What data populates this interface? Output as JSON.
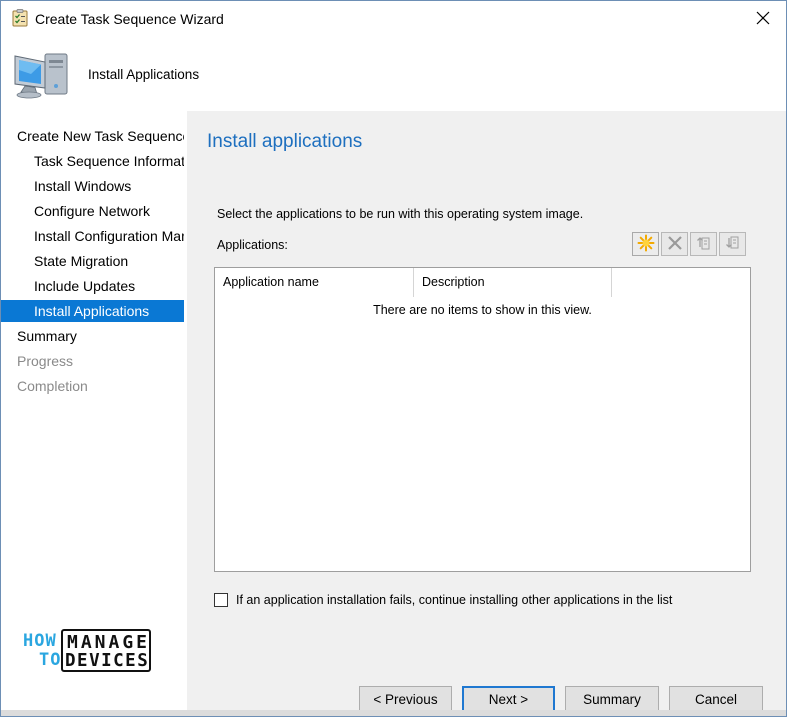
{
  "window": {
    "title": "Create Task Sequence Wizard"
  },
  "header": {
    "title": "Install Applications"
  },
  "nav": {
    "items": [
      {
        "label": "Create New Task Sequence",
        "state": "normal"
      },
      {
        "label": "Task Sequence Information",
        "state": "normal"
      },
      {
        "label": "Install Windows",
        "state": "normal"
      },
      {
        "label": "Configure Network",
        "state": "normal"
      },
      {
        "label": "Install Configuration Manager",
        "state": "normal"
      },
      {
        "label": "State Migration",
        "state": "normal"
      },
      {
        "label": "Include Updates",
        "state": "normal"
      },
      {
        "label": "Install Applications",
        "state": "selected"
      },
      {
        "label": "Summary",
        "state": "normal"
      },
      {
        "label": "Progress",
        "state": "disabled"
      },
      {
        "label": "Completion",
        "state": "disabled"
      }
    ]
  },
  "main": {
    "page_title": "Install applications",
    "instructions": "Select the applications to be run with this operating system image.",
    "apps_label": "Applications:",
    "toolbar": [
      {
        "icon": "new-star-icon"
      },
      {
        "icon": "delete-x-icon"
      },
      {
        "icon": "move-up-icon"
      },
      {
        "icon": "move-down-icon"
      }
    ],
    "list": {
      "columns": [
        "Application name",
        "Description",
        ""
      ],
      "empty_text": "There are no items to show in this view."
    },
    "checkbox": {
      "label": "If an application installation fails, continue installing other applications in the list",
      "checked": false
    }
  },
  "buttons": {
    "previous": "< Previous",
    "next": "Next >",
    "summary": "Summary",
    "cancel": "Cancel"
  },
  "logo": {
    "how": "HOW",
    "to": "TO",
    "manage": "MANAGE",
    "devices": "DEVICES"
  },
  "colors": {
    "accent": "#0a78d4",
    "title_blue": "#1d6fbf",
    "panel_bg": "#f0f0f0",
    "logo_blue": "#2aa6e0"
  }
}
